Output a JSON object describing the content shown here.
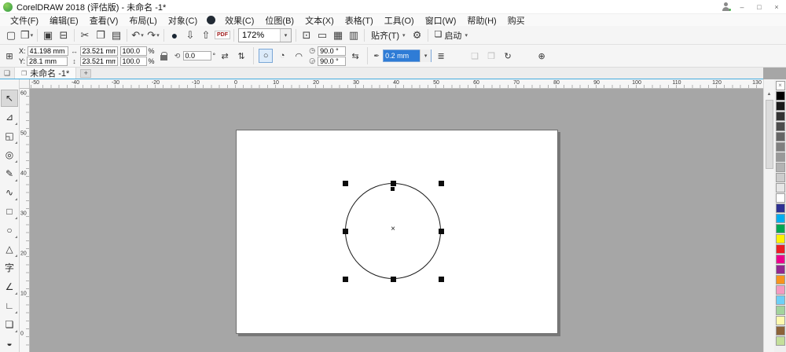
{
  "titlebar": {
    "title": "CorelDRAW 2018 (评估版) - 未命名 -1*",
    "minimize": "–",
    "maximize": "□",
    "close": "×"
  },
  "menubar": {
    "items": [
      "文件(F)",
      "编辑(E)",
      "查看(V)",
      "布局(L)",
      "对象(C)",
      "效果(C)",
      "位图(B)",
      "文本(X)",
      "表格(T)",
      "工具(O)",
      "窗口(W)",
      "帮助(H)",
      "购买"
    ],
    "dot_after_index": 4
  },
  "toolbar": {
    "items": [
      {
        "kind": "button",
        "name": "new-document",
        "glyph": "▢"
      },
      {
        "kind": "button",
        "name": "open",
        "glyph": "❒",
        "drop": true
      },
      {
        "kind": "sep"
      },
      {
        "kind": "button",
        "name": "save",
        "glyph": "▣"
      },
      {
        "kind": "button",
        "name": "print",
        "glyph": "⊟"
      },
      {
        "kind": "sep"
      },
      {
        "kind": "button",
        "name": "cut",
        "glyph": "✂"
      },
      {
        "kind": "button",
        "name": "copy",
        "glyph": "❐"
      },
      {
        "kind": "button",
        "name": "paste",
        "glyph": "▤"
      },
      {
        "kind": "sep"
      },
      {
        "kind": "button",
        "name": "undo",
        "glyph": "↶",
        "drop": true
      },
      {
        "kind": "button",
        "name": "redo",
        "glyph": "↷",
        "drop": true
      },
      {
        "kind": "sep"
      },
      {
        "kind": "button",
        "name": "search-content",
        "glyph": "●",
        "dark": true
      },
      {
        "kind": "button",
        "name": "import",
        "glyph": "⇩"
      },
      {
        "kind": "button",
        "name": "export",
        "glyph": "⇧"
      },
      {
        "kind": "pdf",
        "name": "publish-pdf",
        "label": "PDF"
      },
      {
        "kind": "sep"
      },
      {
        "kind": "zoom",
        "name": "zoom-level",
        "value": "172%"
      },
      {
        "kind": "sep"
      },
      {
        "kind": "button",
        "name": "full-screen-preview",
        "glyph": "⊡"
      },
      {
        "kind": "button",
        "name": "show-rulers",
        "glyph": "▭"
      },
      {
        "kind": "button",
        "name": "show-grid",
        "glyph": "▦"
      },
      {
        "kind": "button",
        "name": "show-guidelines",
        "glyph": "▥"
      },
      {
        "kind": "sep"
      },
      {
        "kind": "snap",
        "name": "snap-to",
        "label": "贴齐(T)"
      },
      {
        "kind": "button",
        "name": "options",
        "glyph": "⚙"
      },
      {
        "kind": "sep"
      },
      {
        "kind": "launch",
        "name": "launch",
        "glyph": "❏",
        "label": "启动"
      }
    ]
  },
  "propbar": {
    "x_label": "X:",
    "x_value": "41.198 mm",
    "y_label": "Y:",
    "y_value": "28.1 mm",
    "width_value": "23.521 mm",
    "height_value": "23.521 mm",
    "scale_x_value": "100.0",
    "scale_y_value": "100.0",
    "percent": "%",
    "rotate_value": "0.0",
    "degree_suffix": "°",
    "start_angle_value": "90.0 °",
    "end_angle_value": "90.0 °",
    "outline_width_value": "0.2 mm",
    "icons": {
      "position": "⊞",
      "width": "↔",
      "height": "↕",
      "rotate": "⟲",
      "mirror_h": "⇄",
      "mirror_v": "⇅",
      "ellipse": "○",
      "pie": "◔",
      "arc": "◠",
      "start_angle": "◷",
      "end_angle": "◶",
      "change_direction": "⇆",
      "outline_pen": "✒",
      "wrap_text": "≣",
      "to_front": "❑",
      "to_back": "❒",
      "convert_curves": "↻",
      "quick_customize": "⊕",
      "dropdown": "▾"
    }
  },
  "tabbar": {
    "home_glyph": "❑",
    "tab_icon": "❒",
    "active_tab": "未命名 -1*",
    "new_tab": "+"
  },
  "rulers": {
    "h_labels": [
      "-50",
      "-40",
      "-30",
      "-20",
      "-10",
      "0",
      "10",
      "20",
      "30",
      "40",
      "50",
      "60",
      "70",
      "80",
      "90",
      "100",
      "110",
      "120",
      "130"
    ],
    "v_labels": [
      "60",
      "50",
      "40",
      "30",
      "20",
      "10",
      "0"
    ]
  },
  "toolbox": {
    "tools": [
      {
        "name": "pick-tool",
        "glyph": "↖",
        "selected": true
      },
      {
        "name": "shape-tool",
        "glyph": "⊿",
        "flyout": true
      },
      {
        "name": "crop-tool",
        "glyph": "◱",
        "flyout": true
      },
      {
        "name": "zoom-tool",
        "glyph": "◎",
        "flyout": true
      },
      {
        "name": "freehand-tool",
        "glyph": "✎",
        "flyout": true
      },
      {
        "name": "artistic-media-tool",
        "glyph": "∿",
        "flyout": true
      },
      {
        "name": "rectangle-tool",
        "glyph": "□",
        "flyout": true
      },
      {
        "name": "ellipse-tool",
        "glyph": "○",
        "flyout": true
      },
      {
        "name": "polygon-tool",
        "glyph": "△",
        "flyout": true
      },
      {
        "name": "text-tool",
        "glyph": "字"
      },
      {
        "name": "dimension-tool",
        "glyph": "∠",
        "flyout": true
      },
      {
        "name": "connector-tool",
        "glyph": "∟",
        "flyout": true
      },
      {
        "name": "drop-shadow-tool",
        "glyph": "❏",
        "flyout": true
      },
      {
        "name": "transparency-tool",
        "glyph": "◒"
      }
    ]
  },
  "palette": {
    "swatches": [
      {
        "name": "no-color",
        "color": "none"
      },
      {
        "name": "black",
        "color": "#000000"
      },
      {
        "name": "90-black",
        "color": "#1a1a1a"
      },
      {
        "name": "80-black",
        "color": "#333333"
      },
      {
        "name": "70-black",
        "color": "#4d4d4d"
      },
      {
        "name": "60-black",
        "color": "#666666"
      },
      {
        "name": "50-black",
        "color": "#808080"
      },
      {
        "name": "40-black",
        "color": "#999999"
      },
      {
        "name": "30-black",
        "color": "#b3b3b3"
      },
      {
        "name": "20-black",
        "color": "#cccccc"
      },
      {
        "name": "10-black",
        "color": "#e6e6e6"
      },
      {
        "name": "white",
        "color": "#ffffff"
      },
      {
        "name": "blue",
        "color": "#2e3192"
      },
      {
        "name": "cyan",
        "color": "#00aeef"
      },
      {
        "name": "green",
        "color": "#00a651"
      },
      {
        "name": "yellow",
        "color": "#fff200"
      },
      {
        "name": "red",
        "color": "#ed1c24"
      },
      {
        "name": "magenta",
        "color": "#ec008c"
      },
      {
        "name": "purple",
        "color": "#92278f"
      },
      {
        "name": "orange",
        "color": "#f7941d"
      },
      {
        "name": "pink",
        "color": "#f49ac1"
      },
      {
        "name": "baby-blue",
        "color": "#6dcff6"
      },
      {
        "name": "mint-green",
        "color": "#a2d39c"
      },
      {
        "name": "light-yellow",
        "color": "#fff9ae"
      },
      {
        "name": "brown",
        "color": "#8c6239"
      },
      {
        "name": "light-green",
        "color": "#c4df9b"
      }
    ]
  },
  "scrollbar": {
    "up_glyph": "▲"
  },
  "canvas": {
    "center_mark": "×"
  }
}
